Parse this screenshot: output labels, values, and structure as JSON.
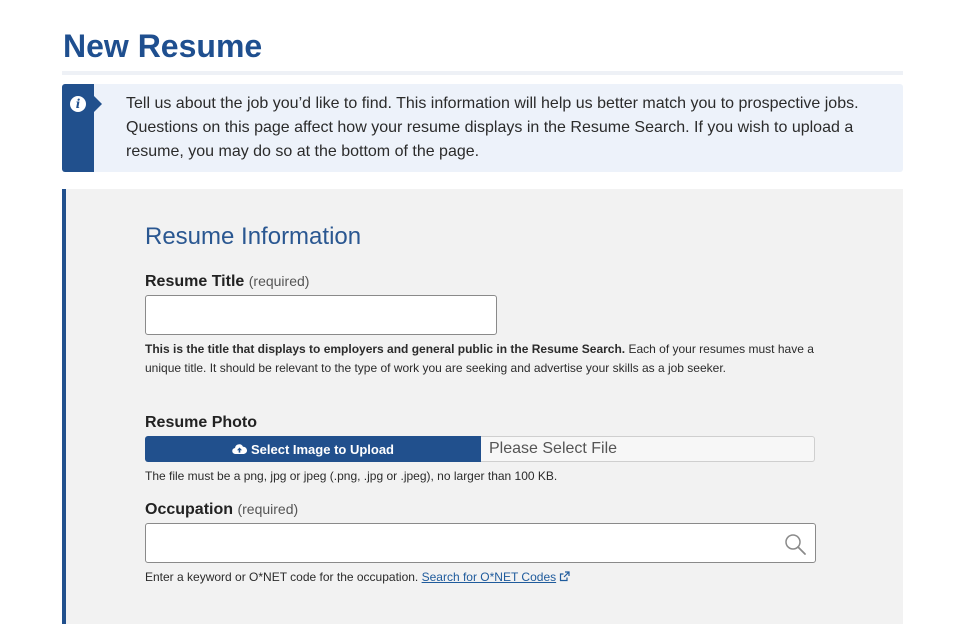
{
  "page": {
    "title": "New Resume"
  },
  "info": {
    "icon": "info-icon",
    "text": "Tell us about the job you’d like to find. This information will help us better match you to prospective jobs. Questions on this page affect how your resume displays in the Resume Search. If you wish to upload a resume, you may do so at the bottom of the page."
  },
  "form": {
    "section_title": "Resume Information",
    "resume_title": {
      "label": "Resume Title",
      "required": "(required)",
      "value": "",
      "help_bold": "This is the title that displays to employers and general public in the Resume Search.",
      "help_rest": " Each of your resumes must have a unique title. It should be relevant to the type of work you are seeking and advertise your skills as a job seeker."
    },
    "photo": {
      "label": "Resume Photo",
      "button_label": "Select Image to Upload",
      "button_icon": "cloud-upload-icon",
      "file_placeholder": "Please Select File",
      "help": "The file must be a png, jpg or jpeg (.png, .jpg or .jpeg), no larger than 100 KB."
    },
    "occupation": {
      "label": "Occupation",
      "required": "(required)",
      "value": "",
      "search_icon": "search-icon",
      "help": "Enter a keyword or O*NET code for the occupation.",
      "link_text": "Search for O*NET Codes",
      "link_icon": "external-link-icon"
    }
  },
  "colors": {
    "primary": "#21508d",
    "info_bg": "#edf2fa",
    "panel_bg": "#f2f2f2"
  }
}
